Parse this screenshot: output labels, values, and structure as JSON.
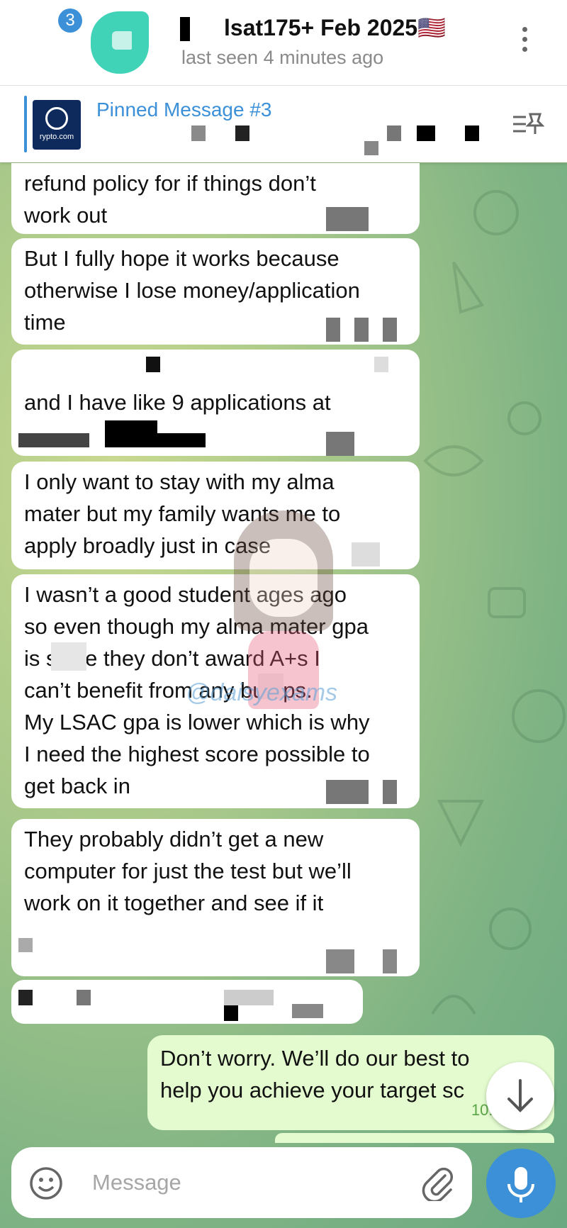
{
  "header": {
    "unread_badge": "3",
    "title": "lsat175+ Feb 2025🇺🇸",
    "status": "last seen 4 minutes ago"
  },
  "pinned": {
    "label": "Pinned Message #3",
    "thumb_text": "rypto.com"
  },
  "messages": [
    {
      "text": "refund policy for if things don’t\nwork out"
    },
    {
      "text": "But I fully hope it works because\notherwise I lose money/application\ntime"
    },
    {
      "text": "and I have like 9 applications at"
    },
    {
      "text": "I only want to stay with my alma\nmater but my family wants me to\napply broadly just in case"
    },
    {
      "text": "I wasn’t a good student ages ago\nso even though my alma mater gpa\nis        since they don’t award A+s I\ncan’t benefit from any      bumps.\nMy LSAC gpa is lower which is why\nI need the highest score possible to\nget back in"
    },
    {
      "text": "They probably didn’t get a new\ncomputer for just the test but we’ll\nwork on it together and see if it"
    }
  ],
  "sent_message": {
    "text": "Don’t worry. We’ll do our best to\nhelp you achieve your target sc",
    "time": "10:57"
  },
  "composer": {
    "placeholder": "Message"
  },
  "watermark": {
    "text": "@daisyexams"
  },
  "colors": {
    "accent": "#3b90d8",
    "sent_bubble": "#e3fbcf",
    "time_green": "#5aa546"
  }
}
